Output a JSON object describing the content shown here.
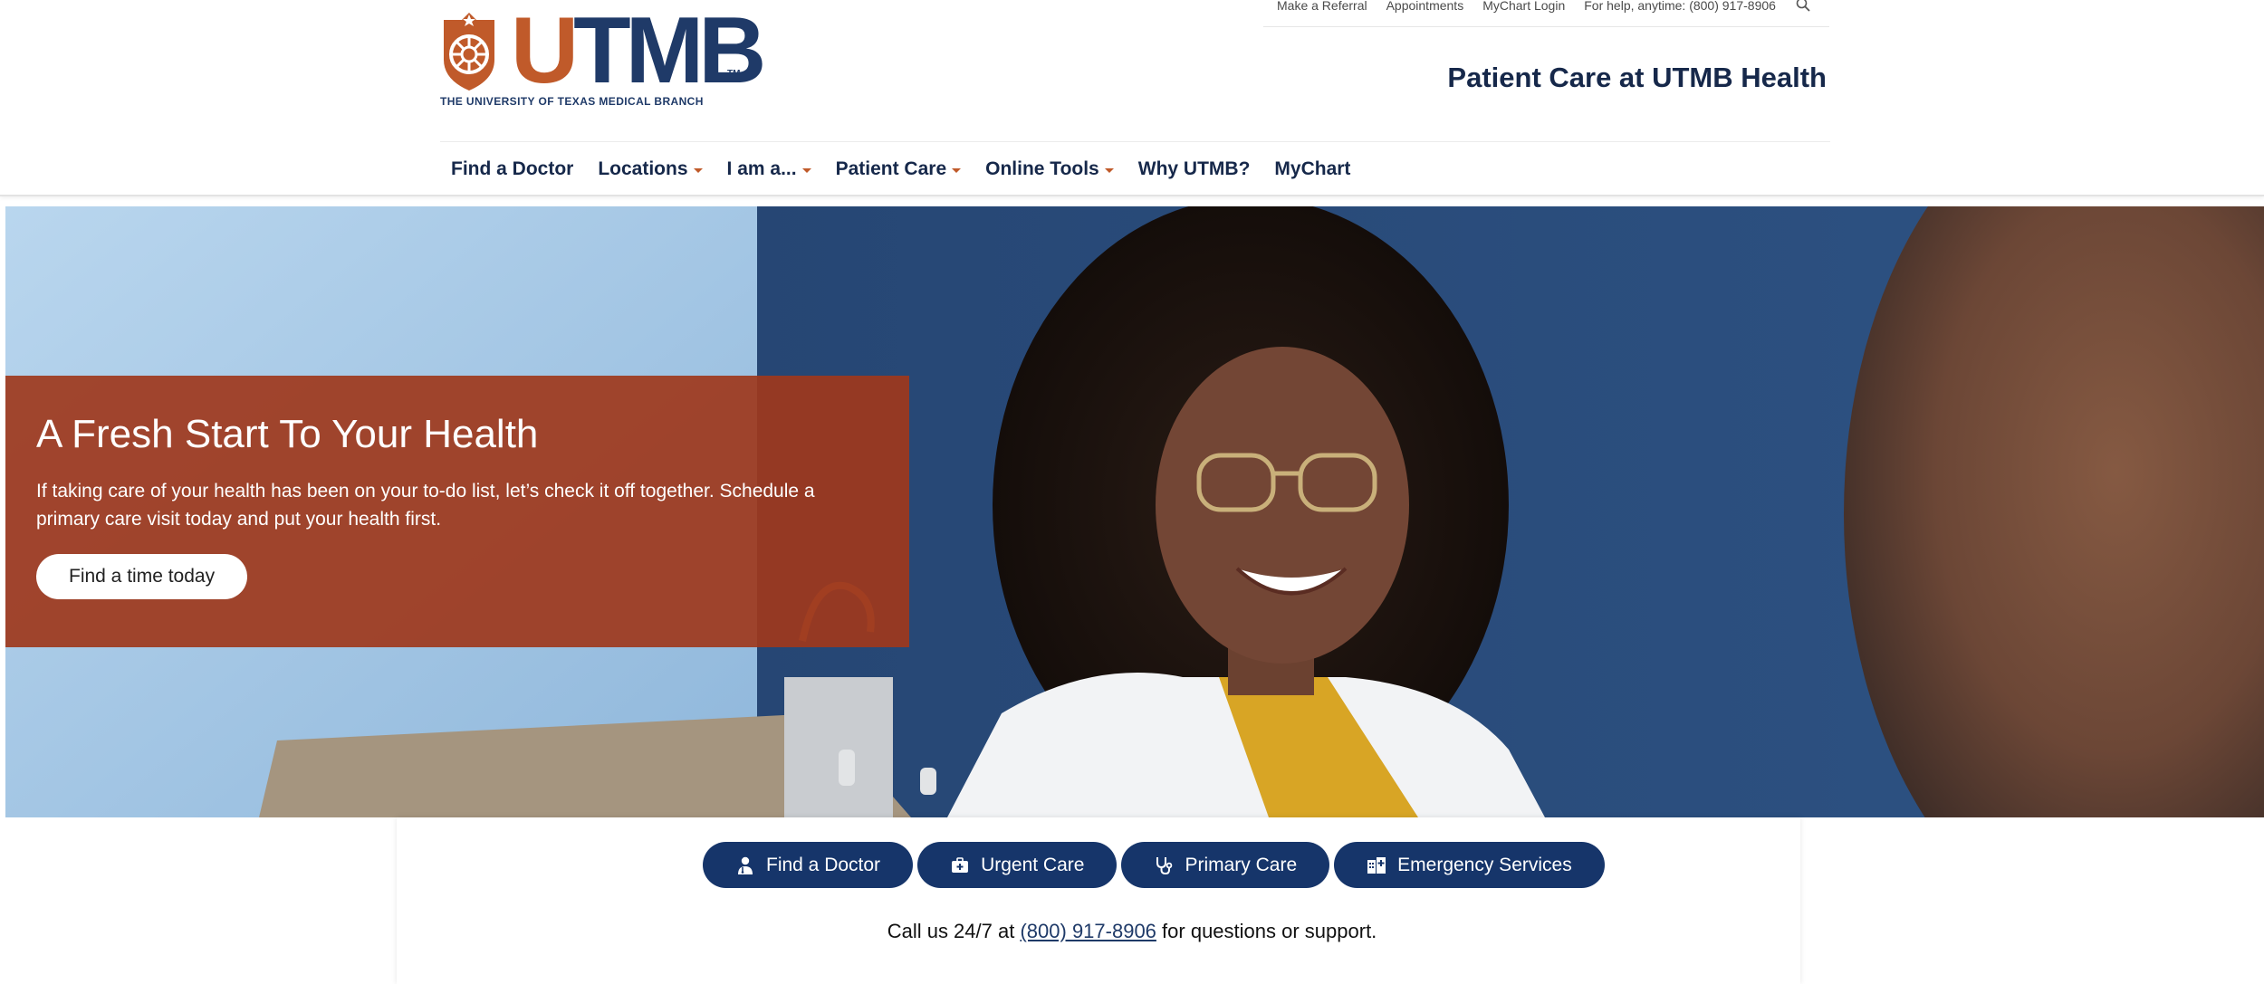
{
  "brand": {
    "wordmark_u": "U",
    "wordmark_tmb": "TMB",
    "trademark": "TM",
    "subtitle": "THE UNIVERSITY OF TEXAS MEDICAL BRANCH",
    "colors": {
      "orange": "#c05a2a",
      "navy": "#1f3a68"
    }
  },
  "utility_nav": {
    "links": [
      "Make a Referral",
      "Appointments",
      "MyChart Login",
      "For help, anytime: (800) 917-8906"
    ],
    "search_icon": "search-icon"
  },
  "site_title": "Patient Care at UTMB Health",
  "main_nav": [
    {
      "label": "Find a Doctor",
      "has_dropdown": false
    },
    {
      "label": "Locations",
      "has_dropdown": true
    },
    {
      "label": "I am a...",
      "has_dropdown": true
    },
    {
      "label": "Patient Care",
      "has_dropdown": true
    },
    {
      "label": "Online Tools",
      "has_dropdown": true
    },
    {
      "label": "Why UTMB?",
      "has_dropdown": false
    },
    {
      "label": "MyChart",
      "has_dropdown": false
    }
  ],
  "hero": {
    "heading": "A Fresh Start To Your Health",
    "body": "If taking care of your health has been on your to-do list, let’s check it off together. Schedule a primary care visit today and put your health first.",
    "cta": "Find a time today",
    "panel_color": "#9e381c"
  },
  "quick_links": [
    {
      "label": "Find a Doctor",
      "icon": "doctor-icon"
    },
    {
      "label": "Urgent Care",
      "icon": "medical-bag-icon"
    },
    {
      "label": "Primary Care",
      "icon": "stethoscope-icon"
    },
    {
      "label": "Emergency Services",
      "icon": "hospital-icon"
    }
  ],
  "contact": {
    "prefix": "Call us 24/7 at",
    "phone": "(800) 917-8906",
    "suffix": "for questions or support."
  },
  "accent_colors": {
    "button_navy": "#16356a"
  }
}
